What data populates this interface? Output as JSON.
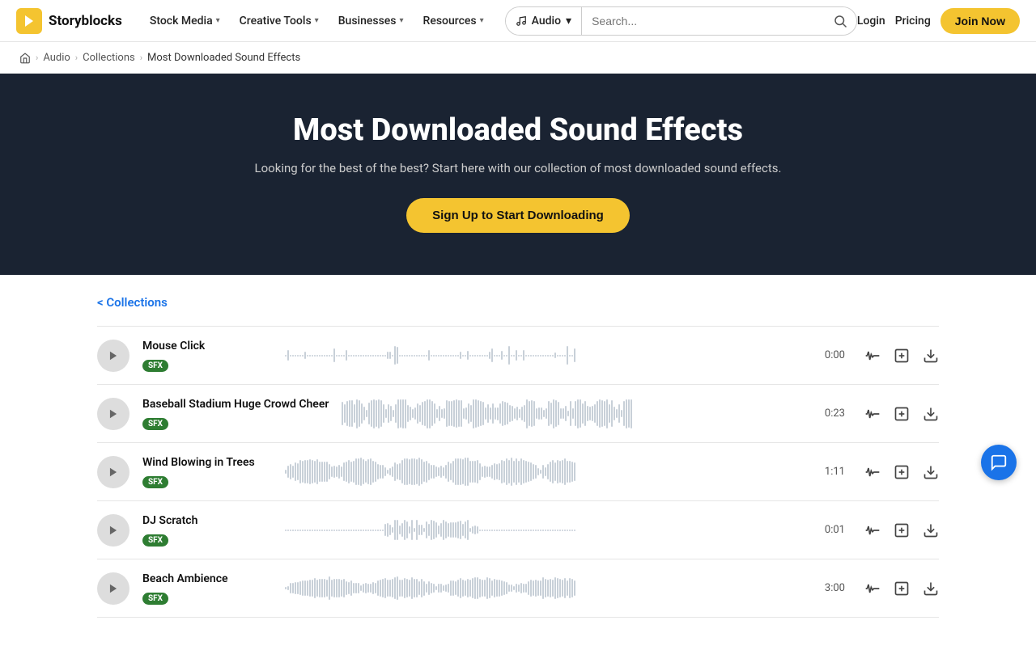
{
  "brand": {
    "logo_letter": "S",
    "name": "Storyblocks"
  },
  "nav": {
    "links": [
      {
        "label": "Stock Media",
        "has_dropdown": true
      },
      {
        "label": "Creative Tools",
        "has_dropdown": true
      },
      {
        "label": "Businesses",
        "has_dropdown": true
      },
      {
        "label": "Resources",
        "has_dropdown": true
      }
    ],
    "search_type": "Audio",
    "search_placeholder": "Search...",
    "login_label": "Login",
    "pricing_label": "Pricing",
    "join_label": "Join Now"
  },
  "breadcrumb": {
    "home": "Home",
    "audio": "Audio",
    "collections": "Collections",
    "current": "Most Downloaded Sound Effects"
  },
  "hero": {
    "title": "Most Downloaded Sound Effects",
    "subtitle": "Looking for the best of the best? Start here with our collection of most downloaded sound effects.",
    "cta": "Sign Up to Start Downloading"
  },
  "collections_link": "< Collections",
  "tracks": [
    {
      "name": "Mouse Click",
      "badge": "SFX",
      "duration": "0:00",
      "waveform_style": "sparse"
    },
    {
      "name": "Baseball Stadium Huge Crowd Cheer",
      "badge": "SFX",
      "duration": "0:23",
      "waveform_style": "dense"
    },
    {
      "name": "Wind Blowing in Trees",
      "badge": "SFX",
      "duration": "1:11",
      "waveform_style": "medium"
    },
    {
      "name": "DJ Scratch",
      "badge": "SFX",
      "duration": "0:01",
      "waveform_style": "sparse_mid"
    },
    {
      "name": "Beach Ambience",
      "badge": "SFX",
      "duration": "3:00",
      "waveform_style": "medium_long"
    }
  ]
}
